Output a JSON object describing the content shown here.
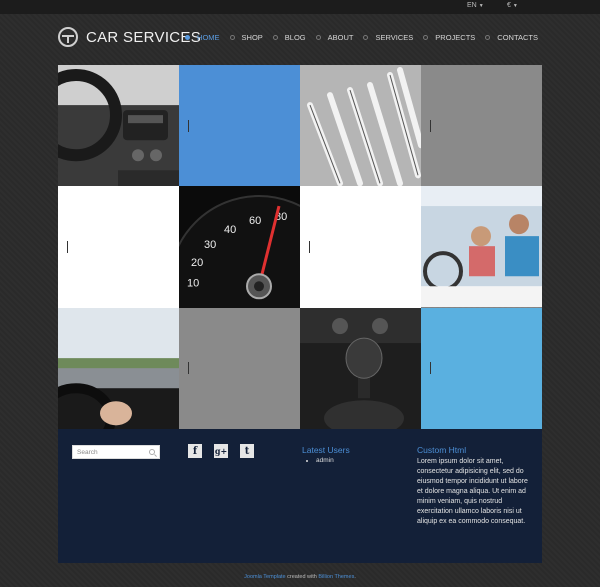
{
  "topbar": {
    "language": "EN",
    "currency": "€"
  },
  "logo": {
    "title": "CAR SERVICES"
  },
  "nav": {
    "items": [
      {
        "label": "HOME",
        "active": true
      },
      {
        "label": "SHOP"
      },
      {
        "label": "BLOG"
      },
      {
        "label": "ABOUT"
      },
      {
        "label": "SERVICES"
      },
      {
        "label": "PROJECTS"
      },
      {
        "label": "CONTACTS"
      }
    ]
  },
  "colors": {
    "accent": "#4c8fd6",
    "panel": "#132038",
    "grey_tile": "#8a8a8a",
    "light_blue_tile": "#5ab0e0"
  },
  "footer": {
    "search_placeholder": "Search",
    "socials": [
      "f",
      "g+",
      "t"
    ],
    "latest_users": {
      "title": "Latest Users",
      "items": [
        "admin"
      ]
    },
    "custom_html": {
      "title": "Custom Html",
      "text": "Lorem ipsum dolor sit amet, consectetur adipisicing elit, sed do eiusmod tempor incididunt ut labore et dolore magna aliqua. Ut enim ad minim veniam, quis nostrud exercitation ullamco laboris nisi ut aliquip ex ea commodo consequat."
    }
  },
  "credit": {
    "link1": "Joomla Template",
    "middle": " created with ",
    "link2": "Billion Themes",
    "end": "."
  }
}
